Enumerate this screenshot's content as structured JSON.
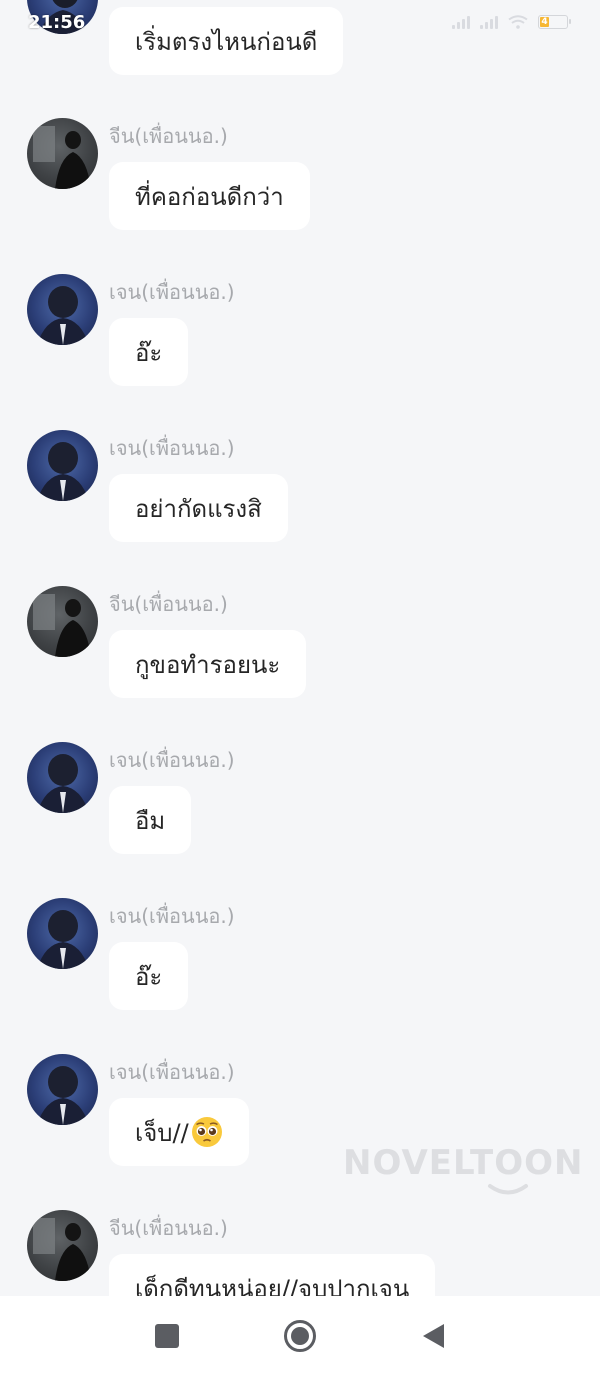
{
  "status_bar": {
    "time": "21:56",
    "battery_level_text": "4",
    "battery_level_fraction": 0.35,
    "colors": {
      "battery": "#f7b733"
    }
  },
  "chat": {
    "first_message_text": "เริ่มตรงไหนก่อนดี",
    "messages": [
      {
        "sender": "จีน(เพื่อนนอ.)",
        "avatar": "jean",
        "text": "ที่คอก่อนดีกว่า"
      },
      {
        "sender": "เจน(เพื่อนนอ.)",
        "avatar": "jen",
        "text": "อ๊ะ"
      },
      {
        "sender": "เจน(เพื่อนนอ.)",
        "avatar": "jen",
        "text": "อย่ากัดแรงสิ"
      },
      {
        "sender": "จีน(เพื่อนนอ.)",
        "avatar": "jean",
        "text": "กูขอทำรอยนะ"
      },
      {
        "sender": "เจน(เพื่อนนอ.)",
        "avatar": "jen",
        "text": "อืม"
      },
      {
        "sender": "เจน(เพื่อนนอ.)",
        "avatar": "jen",
        "text": "อ๊ะ"
      },
      {
        "sender": "เจน(เพื่อนนอ.)",
        "avatar": "jen",
        "text": "เจ็บ//",
        "emoji": "pleading-face-emoji"
      },
      {
        "sender": "จีน(เพื่อนนอ.)",
        "avatar": "jean",
        "text": "เด็กดีทนหน่อย//จูบปากเจน"
      }
    ]
  },
  "watermark": {
    "text": "NOVELTOON"
  },
  "nav_bar": {
    "icons": [
      "recent-apps-icon",
      "home-icon",
      "back-icon"
    ]
  },
  "colors": {
    "background": "#f5f6f8",
    "bubble": "#ffffff",
    "sender": "#a7a9ad",
    "message_text": "#262626"
  }
}
